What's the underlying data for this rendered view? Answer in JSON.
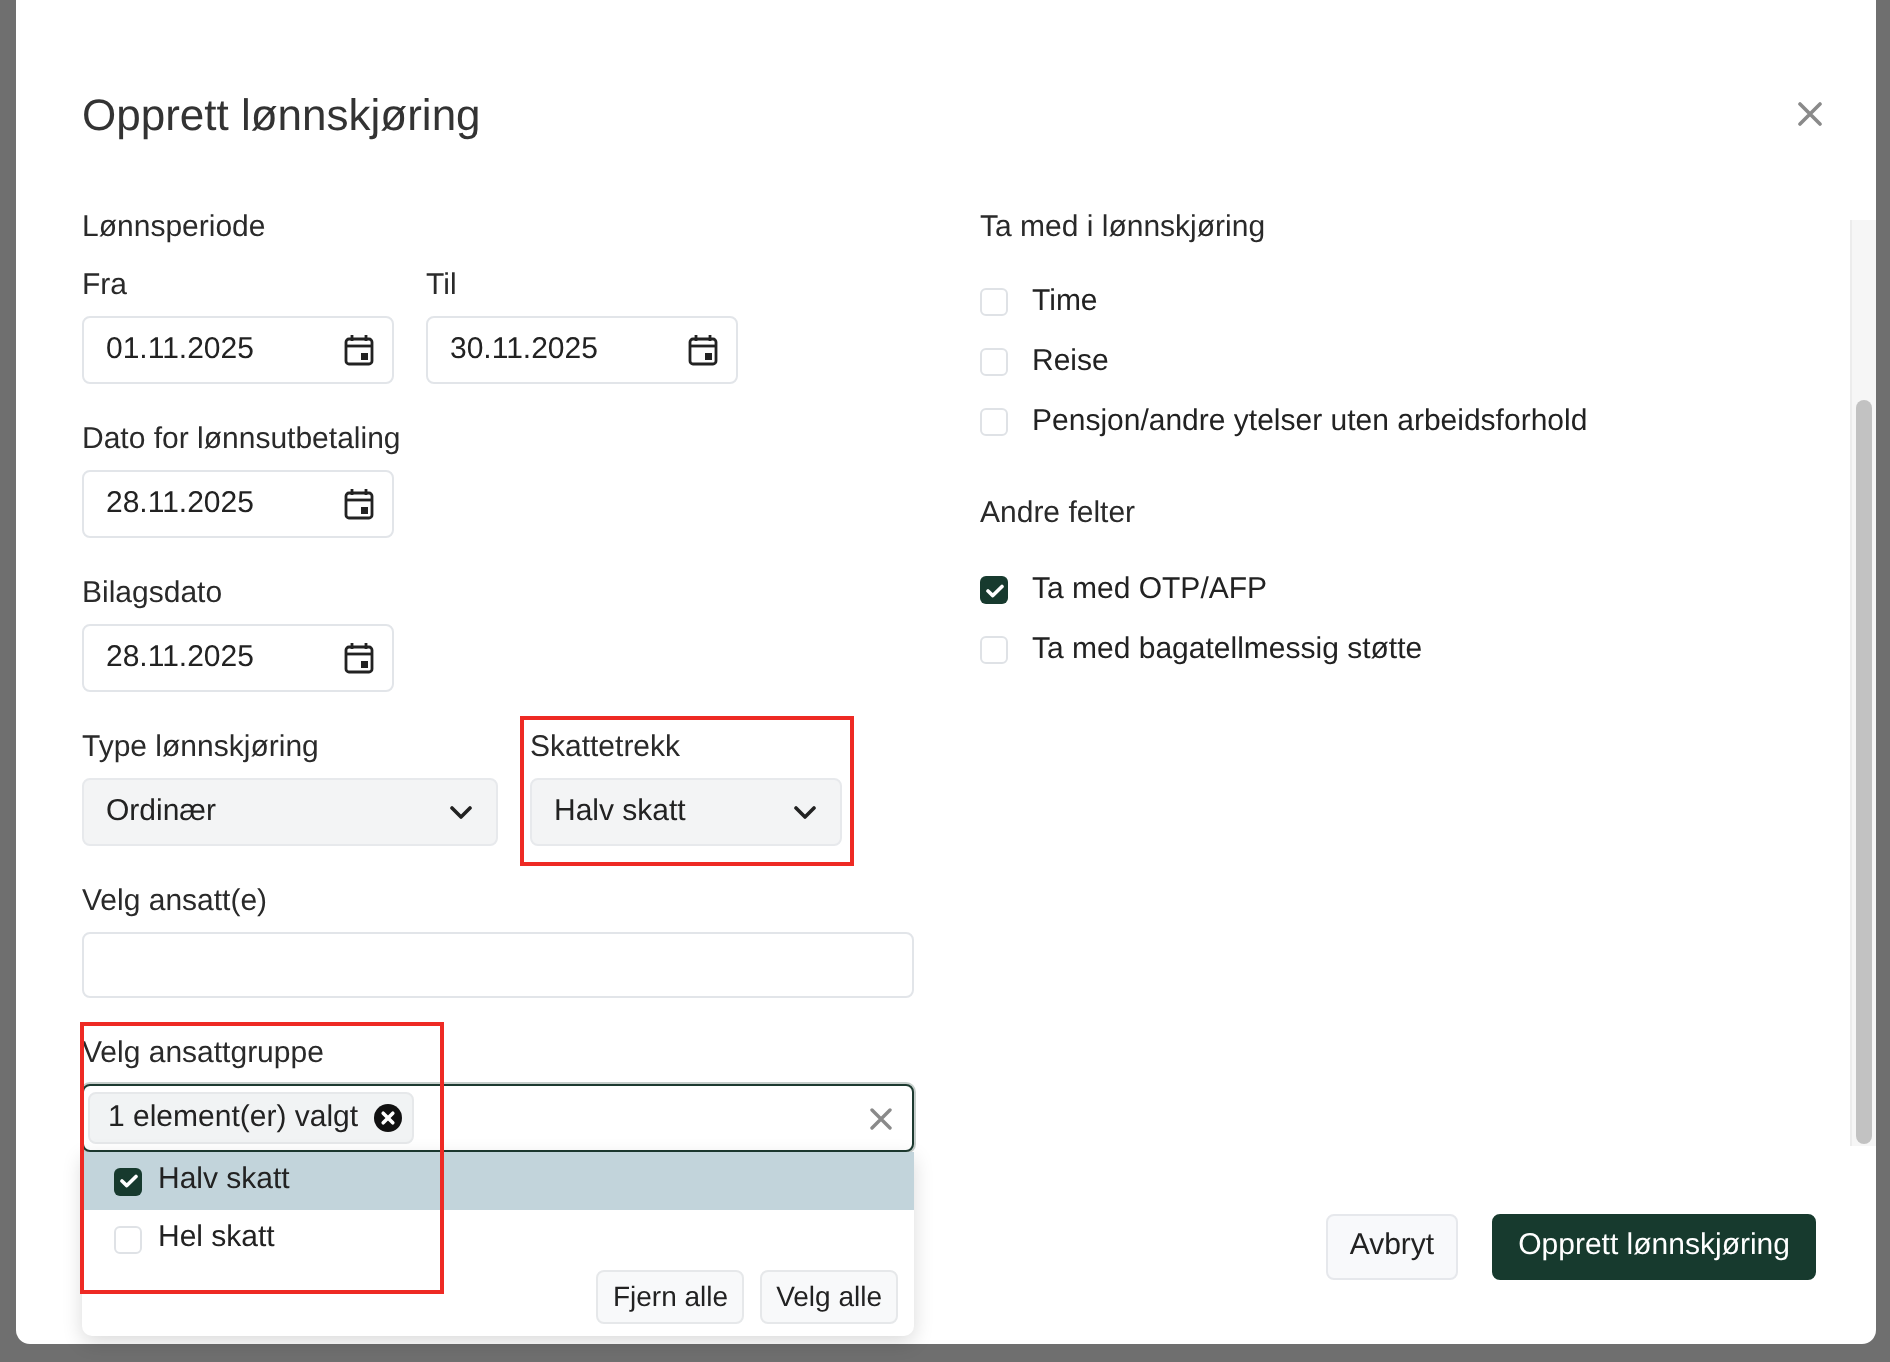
{
  "dialog": {
    "title": "Opprett lønnskjøring"
  },
  "pay_period": {
    "label": "Lønnsperiode",
    "fields": [
      {
        "label": "Fra",
        "value": "01.11.2025"
      },
      {
        "label": "Til",
        "value": "30.11.2025"
      }
    ]
  },
  "payment_date": {
    "label": "Dato for lønnsutbetaling",
    "value": "28.11.2025"
  },
  "voucher_date": {
    "label": "Bilagsdato",
    "value": "28.11.2025"
  },
  "selects": [
    {
      "label": "Type lønnskjøring",
      "value": "Ordinær"
    },
    {
      "label": "Skattetrekk",
      "value": "Halv skatt",
      "annotated": true
    }
  ],
  "employees": {
    "label": "Velg ansatt(e)"
  },
  "employee_group": {
    "label": "Velg ansattgruppe",
    "focused": true,
    "annotated": true,
    "chip": "1 element(er) valgt",
    "options": [
      {
        "label": "Halv skatt",
        "checked": true,
        "highlighted": true
      },
      {
        "label": "Hel skatt",
        "checked": false,
        "highlighted": false
      }
    ],
    "actions": [
      "Fjern alle",
      "Velg alle"
    ]
  },
  "include_section": {
    "title": "Ta med i lønnskjøring",
    "options": [
      {
        "label": "Time",
        "checked": false
      },
      {
        "label": "Reise",
        "checked": false
      },
      {
        "label": "Pensjon/andre ytelser uten arbeidsforhold",
        "checked": false
      }
    ]
  },
  "other_fields": {
    "title": "Andre felter",
    "options": [
      {
        "label": "Ta med OTP/AFP",
        "checked": true
      },
      {
        "label": "Ta med bagatellmessig støtte",
        "checked": false
      }
    ]
  },
  "footer": {
    "buttons": [
      {
        "label": "Avbryt",
        "kind": "secondary"
      },
      {
        "label": "Opprett lønnskjøring",
        "kind": "primary"
      }
    ]
  }
}
